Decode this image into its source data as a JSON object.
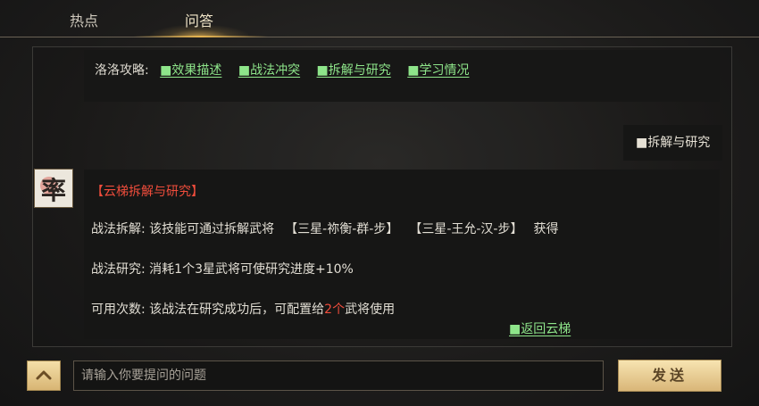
{
  "tabs": {
    "hot": "热点",
    "qa": "问答"
  },
  "tips": {
    "prefix": "洛洛攻略:",
    "links": [
      "■效果描述",
      "■战法冲突",
      "■拆解与研究",
      "■学习情况"
    ]
  },
  "user_message": "■拆解与研究",
  "avatar": {
    "glyph": "率"
  },
  "reply": {
    "title": "【云梯拆解与研究】",
    "line1": {
      "label": "战法拆解: 该技能可通过拆解武将",
      "item1": "【三星-祢衡-群-步】",
      "item2": "【三星-王允-汉-步】",
      "suffix": "获得"
    },
    "line2": "战法研究: 消耗1个3星武将可使研究进度+10%",
    "line3": {
      "prefix": "可用次数: 该战法在研究成功后，可配置给",
      "count": "2个",
      "suffix": "武将使用"
    },
    "back_link": "■返回云梯"
  },
  "input": {
    "placeholder": "请输入你要提问的问题"
  },
  "send_label": "发送",
  "colors": {
    "link": "#8ee58a",
    "accent_red": "#f04d3c",
    "gold": "#e6b450"
  }
}
